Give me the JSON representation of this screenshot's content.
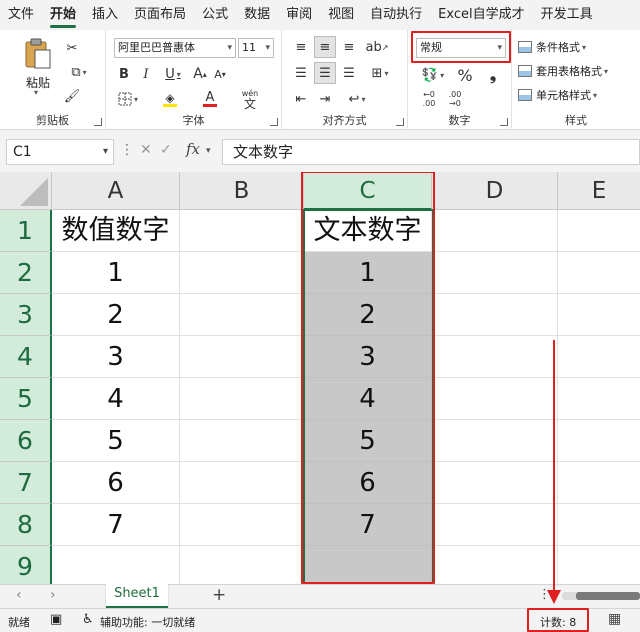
{
  "menu": {
    "tabs": [
      "文件",
      "开始",
      "插入",
      "页面布局",
      "公式",
      "数据",
      "审阅",
      "视图",
      "自动执行",
      "Excel自学成才",
      "开发工具"
    ],
    "active_tab": "开始"
  },
  "ribbon": {
    "clipboard": {
      "paste_label": "粘贴",
      "group_label": "剪贴板"
    },
    "font": {
      "font_name": "阿里巴巴普惠体",
      "font_size": "11",
      "group_label": "字体",
      "phonetic_label": "wén"
    },
    "alignment": {
      "group_label": "对齐方式"
    },
    "number": {
      "format_value": "常规",
      "percent_symbol": "%",
      "comma_symbol": "❟",
      "group_label": "数字"
    },
    "styles": {
      "conditional_format": "条件格式",
      "table_format": "套用表格格式",
      "cell_styles": "单元格样式",
      "group_label": "样式"
    }
  },
  "formula_bar": {
    "name_box": "C1",
    "fx_label": "fx",
    "content": "文本数字"
  },
  "grid": {
    "columns": [
      "A",
      "B",
      "C",
      "D",
      "E"
    ],
    "rows": [
      "1",
      "2",
      "3",
      "4",
      "5",
      "6",
      "7",
      "8",
      "9"
    ],
    "col_a": [
      "数值数字",
      "1",
      "2",
      "3",
      "4",
      "5",
      "6",
      "7",
      ""
    ],
    "col_c": [
      "文本数字",
      "1",
      "2",
      "3",
      "4",
      "5",
      "6",
      "7",
      ""
    ],
    "selected_column": "C"
  },
  "sheets": {
    "tabs": [
      "Sheet1"
    ],
    "add_symbol": "+"
  },
  "status": {
    "ready": "就绪",
    "accessibility": "辅助功能: 一切就绪",
    "count": "计数: 8"
  },
  "colors": {
    "accent_green": "#1e7145",
    "annotation_red": "#e02020",
    "selection_fill": "#c8c8c8"
  }
}
